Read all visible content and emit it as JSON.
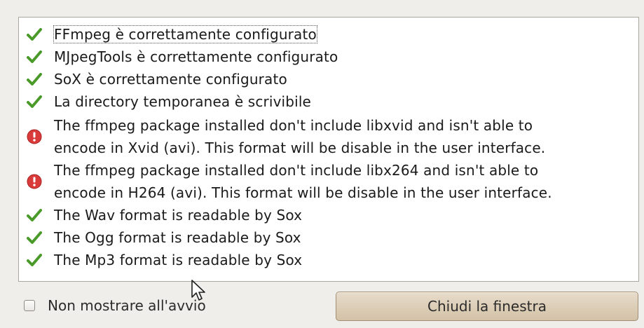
{
  "messages": [
    {
      "status": "ok",
      "icon": "check-icon",
      "lines": [
        "FFmpeg è correttamente configurato"
      ]
    },
    {
      "status": "ok",
      "icon": "check-icon",
      "lines": [
        "MJpegTools è correttamente configurato"
      ]
    },
    {
      "status": "ok",
      "icon": "check-icon",
      "lines": [
        "SoX è correttamente configurato"
      ]
    },
    {
      "status": "ok",
      "icon": "check-icon",
      "lines": [
        "La directory temporanea è scrivibile"
      ]
    },
    {
      "status": "error",
      "icon": "error-icon",
      "lines": [
        "The ffmpeg package installed don't include libxvid and isn't able to",
        "encode in Xvid (avi). This format will be disable in the user interface."
      ]
    },
    {
      "status": "error",
      "icon": "error-icon",
      "lines": [
        "The ffmpeg package installed don't include libx264 and isn't able to",
        "encode in H264 (avi). This format will be disable in the user interface."
      ]
    },
    {
      "status": "ok",
      "icon": "check-icon",
      "lines": [
        "The Wav format is readable by Sox"
      ]
    },
    {
      "status": "ok",
      "icon": "check-icon",
      "lines": [
        "The Ogg format is readable by Sox"
      ]
    },
    {
      "status": "ok",
      "icon": "check-icon",
      "lines": [
        "The Mp3 format is readable by Sox"
      ]
    }
  ],
  "footer": {
    "checkbox_label": "Non mostrare all'avvio",
    "checkbox_checked": false,
    "close_label": "Chiudi la finestra"
  },
  "colors": {
    "ok": "#4a9a2a",
    "error": "#d93b3b"
  }
}
